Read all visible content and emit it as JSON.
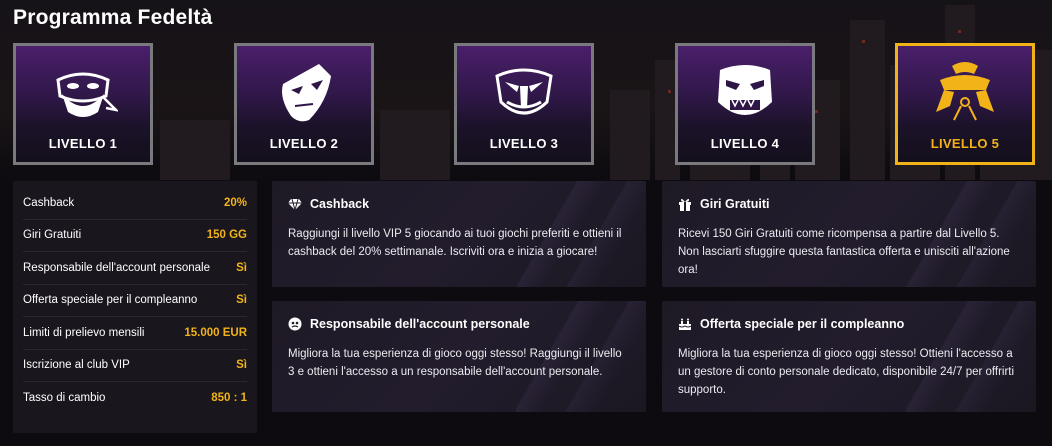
{
  "page": {
    "title": "Programma Fedeltà"
  },
  "levels": [
    {
      "label": "LIVELLO 1",
      "icon": "bandana-mask-icon",
      "active": false
    },
    {
      "label": "LIVELLO 2",
      "icon": "fox-mask-icon",
      "active": false
    },
    {
      "label": "LIVELLO 3",
      "icon": "tengu-mask-icon",
      "active": false
    },
    {
      "label": "LIVELLO 4",
      "icon": "oni-mask-icon",
      "active": true
    },
    {
      "label": "LIVELLO 5",
      "icon": "samurai-helmet-icon",
      "active": true
    }
  ],
  "stats": [
    {
      "label": "Cashback",
      "value": "20%"
    },
    {
      "label": "Giri Gratuiti",
      "value": "150 GG"
    },
    {
      "label": "Responsabile dell'account personale",
      "value": "Sì"
    },
    {
      "label": "Offerta speciale per il compleanno",
      "value": "Sì"
    },
    {
      "label": "Limiti di prelievo mensili",
      "value": "15.000 EUR"
    },
    {
      "label": "Iscrizione al club VIP",
      "value": "Sì"
    },
    {
      "label": "Tasso di cambio",
      "value": "850 : 1"
    }
  ],
  "cards": [
    {
      "title": "Cashback",
      "icon": "diamond-icon",
      "text": "Raggiungi il livello VIP 5 giocando ai tuoi giochi preferiti e ottieni il cashback del 20% settimanale. Iscriviti ora e inizia a giocare!"
    },
    {
      "title": "Giri Gratuiti",
      "icon": "gift-icon",
      "text": "Ricevi 150 Giri Gratuiti come ricompensa a partire dal Livello 5. Non lasciarti sfuggire questa fantastica offerta e unisciti all'azione ora!"
    },
    {
      "title": "Responsabile dell'account personale",
      "icon": "manager-icon",
      "text": "Migliora la tua esperienza di gioco oggi stesso! Raggiungi il livello 3 e ottieni l'accesso a un responsabile dell'account personale."
    },
    {
      "title": "Offerta speciale per il compleanno",
      "icon": "birthday-cake-icon",
      "text": "Migliora la tua esperienza di gioco oggi stesso! Ottieni l'accesso a un gestore di conto personale dedicato, disponibile 24/7 per offrirti supporto."
    }
  ],
  "colors": {
    "accent": "#f2b319",
    "border": "#7a7a7e",
    "card_bg": "#1e1a25"
  }
}
